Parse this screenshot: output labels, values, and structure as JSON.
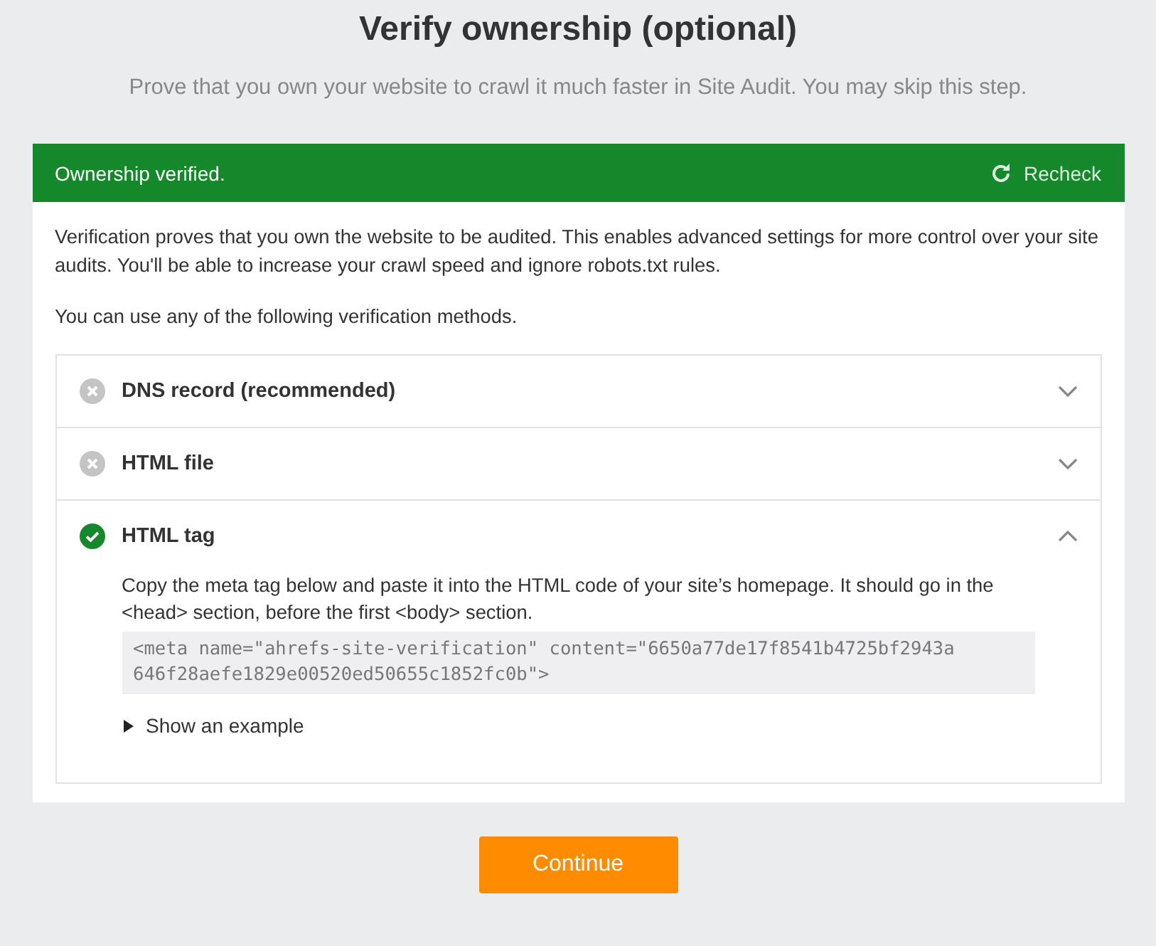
{
  "heading": "Verify ownership (optional)",
  "subheading": "Prove that you own your website to crawl it much faster in Site Audit. You may skip this step.",
  "status_bar": {
    "message": "Ownership verified.",
    "verified": true,
    "action": "Recheck"
  },
  "intro": "Verification proves that you own the website to be audited. This enables advanced settings for more control over your site audits. You'll be able to increase your crawl speed and ignore robots.txt rules.",
  "methods_intro": "You can use any of the following verification methods.",
  "methods": [
    {
      "title": "DNS record (recommended)",
      "verified": false,
      "expanded": false
    },
    {
      "title": "HTML file",
      "verified": false,
      "expanded": false
    },
    {
      "title": "HTML tag",
      "verified": true,
      "expanded": true,
      "instructions": "Copy the meta tag below and paste it into the HTML code of your site’s homepage. It should go in the <head> section, before the first <body> section.",
      "code": "<meta name=\"ahrefs-site-verification\" content=\"6650a77de17f8541b4725bf2943a646f28aefe1829e00520ed50655c1852fc0b\">",
      "example": {
        "label": "Show an example",
        "expanded": false
      }
    }
  ],
  "primary_button": "Continue"
}
